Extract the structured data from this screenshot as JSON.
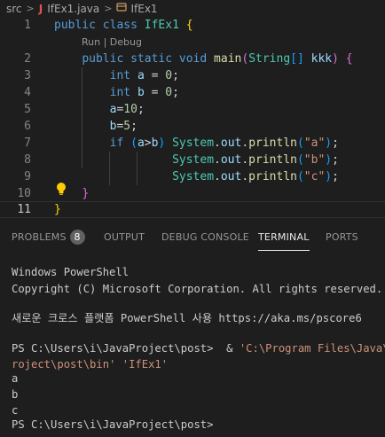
{
  "breadcrumb": {
    "folder": "src",
    "file": "IfEx1.java",
    "file_icon": "J",
    "symbol": "IfEx1"
  },
  "editor": {
    "codelens": "Run | Debug",
    "lines": [
      {
        "n": "1",
        "tokens": [
          [
            "kw",
            "public"
          ],
          [
            "plain",
            " "
          ],
          [
            "kw",
            "class"
          ],
          [
            "plain",
            " "
          ],
          [
            "ty",
            "IfEx1"
          ],
          [
            "plain",
            " "
          ],
          [
            "br1",
            "{"
          ]
        ]
      },
      {
        "n": "2",
        "tokens": [
          [
            "plain",
            "    "
          ],
          [
            "kw",
            "public"
          ],
          [
            "plain",
            " "
          ],
          [
            "kw",
            "static"
          ],
          [
            "plain",
            " "
          ],
          [
            "kw",
            "void"
          ],
          [
            "plain",
            " "
          ],
          [
            "fn",
            "main"
          ],
          [
            "br2",
            "("
          ],
          [
            "ty",
            "String"
          ],
          [
            "br3",
            "[]"
          ],
          [
            "plain",
            " "
          ],
          [
            "var",
            "kkk"
          ],
          [
            "br2",
            ")"
          ],
          [
            "plain",
            " "
          ],
          [
            "br2",
            "{"
          ]
        ]
      },
      {
        "n": "3",
        "tokens": [
          [
            "plain",
            "        "
          ],
          [
            "kw",
            "int"
          ],
          [
            "plain",
            " "
          ],
          [
            "var",
            "a"
          ],
          [
            "plain",
            " = "
          ],
          [
            "num",
            "0"
          ],
          [
            "plain",
            ";"
          ]
        ]
      },
      {
        "n": "4",
        "tokens": [
          [
            "plain",
            "        "
          ],
          [
            "kw",
            "int"
          ],
          [
            "plain",
            " "
          ],
          [
            "var",
            "b"
          ],
          [
            "plain",
            " = "
          ],
          [
            "num",
            "0"
          ],
          [
            "plain",
            ";"
          ]
        ]
      },
      {
        "n": "5",
        "tokens": [
          [
            "plain",
            "        "
          ],
          [
            "var",
            "a"
          ],
          [
            "plain",
            "="
          ],
          [
            "num",
            "10"
          ],
          [
            "plain",
            ";"
          ]
        ]
      },
      {
        "n": "6",
        "tokens": [
          [
            "plain",
            "        "
          ],
          [
            "var",
            "b"
          ],
          [
            "plain",
            "="
          ],
          [
            "num",
            "5"
          ],
          [
            "plain",
            ";"
          ]
        ]
      },
      {
        "n": "7",
        "tokens": [
          [
            "plain",
            "        "
          ],
          [
            "kw",
            "if"
          ],
          [
            "plain",
            " "
          ],
          [
            "br3",
            "("
          ],
          [
            "var",
            "a"
          ],
          [
            "plain",
            ">"
          ],
          [
            "var",
            "b"
          ],
          [
            "br3",
            ")"
          ],
          [
            "plain",
            " "
          ],
          [
            "ty",
            "System"
          ],
          [
            "plain",
            "."
          ],
          [
            "var",
            "out"
          ],
          [
            "plain",
            "."
          ],
          [
            "fn",
            "println"
          ],
          [
            "br3",
            "("
          ],
          [
            "str",
            "\"a\""
          ],
          [
            "br3",
            ")"
          ],
          [
            "plain",
            ";"
          ]
        ]
      },
      {
        "n": "8",
        "tokens": [
          [
            "plain",
            "                 "
          ],
          [
            "ty",
            "System"
          ],
          [
            "plain",
            "."
          ],
          [
            "var",
            "out"
          ],
          [
            "plain",
            "."
          ],
          [
            "fn",
            "println"
          ],
          [
            "br3",
            "("
          ],
          [
            "str",
            "\"b\""
          ],
          [
            "br3",
            ")"
          ],
          [
            "plain",
            ";"
          ]
        ]
      },
      {
        "n": "9",
        "tokens": [
          [
            "plain",
            "                 "
          ],
          [
            "ty",
            "System"
          ],
          [
            "plain",
            "."
          ],
          [
            "var",
            "out"
          ],
          [
            "plain",
            "."
          ],
          [
            "fn",
            "println"
          ],
          [
            "br3",
            "("
          ],
          [
            "str",
            "\"c\""
          ],
          [
            "br3",
            ")"
          ],
          [
            "plain",
            ";"
          ]
        ]
      },
      {
        "n": "10",
        "tokens": [
          [
            "plain",
            "    "
          ],
          [
            "br2",
            "}"
          ]
        ]
      },
      {
        "n": "11",
        "tokens": [
          [
            "br1",
            "}"
          ]
        ]
      }
    ]
  },
  "panel": {
    "tabs": [
      {
        "label": "PROBLEMS",
        "badge": "8"
      },
      {
        "label": "OUTPUT"
      },
      {
        "label": "DEBUG CONSOLE"
      },
      {
        "label": "TERMINAL"
      },
      {
        "label": "PORTS"
      }
    ],
    "active_tab": "TERMINAL"
  },
  "terminal": {
    "lines": [
      [
        [
          "tplain",
          "Windows PowerShell"
        ]
      ],
      [
        [
          "tplain",
          "Copyright (C) Microsoft Corporation. All rights reserved."
        ]
      ],
      [
        [
          "tplain",
          ""
        ]
      ],
      [
        [
          "tplain",
          "새로운 크로스 플랫폼 PowerShell 사용 https://aka.ms/pscore6"
        ]
      ],
      [
        [
          "tplain",
          ""
        ]
      ],
      [
        [
          "tplain",
          "PS C:\\Users\\i\\JavaProject\\post>  & "
        ],
        [
          "tstr",
          "'C:\\Program Files\\Java\\jd"
        ]
      ],
      [
        [
          "tstr",
          "roject\\post\\bin'"
        ],
        [
          "tplain",
          " "
        ],
        [
          "tstr",
          "'IfEx1'"
        ]
      ],
      [
        [
          "tplain",
          "a"
        ]
      ],
      [
        [
          "tplain",
          "b"
        ]
      ],
      [
        [
          "tplain",
          "c"
        ]
      ],
      [
        [
          "tplain",
          "PS C:\\Users\\i\\JavaProject\\post> "
        ]
      ]
    ]
  },
  "colors": {
    "background": "#1e1e1e",
    "keyword": "#569cd6",
    "type": "#4ec9b0",
    "function": "#dcdcaa",
    "string": "#ce9178",
    "number": "#b5cea8",
    "variable": "#9cdcfe",
    "lightbulb": "#ffcc00"
  }
}
